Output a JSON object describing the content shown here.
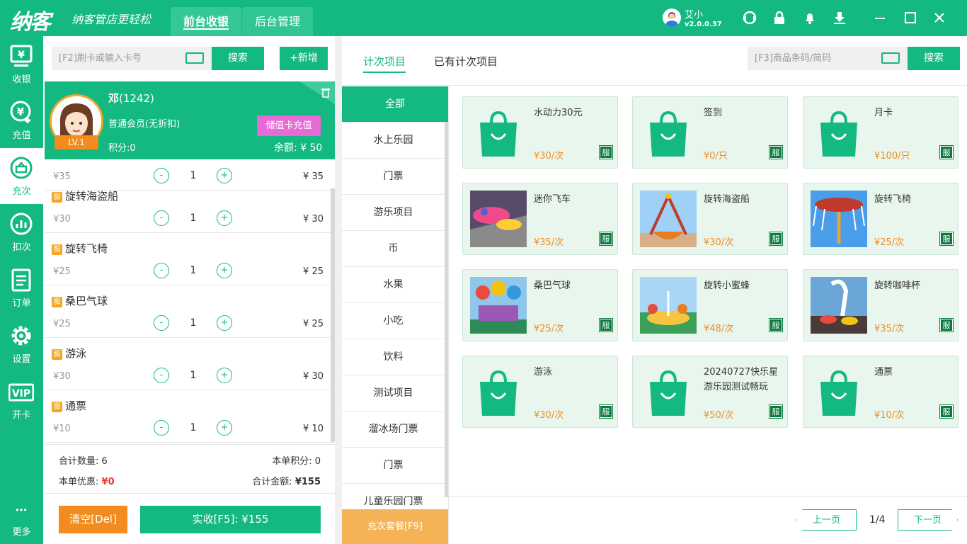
{
  "header": {
    "logo": "纳客",
    "slogan": "纳客管店更轻松",
    "tabs": [
      {
        "label": "前台收银"
      },
      {
        "label": "后台管理"
      }
    ],
    "user": {
      "name": "艾小",
      "version": "v2.0.0.37"
    }
  },
  "nav": [
    {
      "label": "收银",
      "icon": "cashier-icon"
    },
    {
      "label": "充值",
      "icon": "recharge-icon"
    },
    {
      "label": "充次",
      "icon": "recharge-times-icon"
    },
    {
      "label": "扣次",
      "icon": "deduct-times-icon"
    },
    {
      "label": "订单",
      "icon": "order-icon"
    },
    {
      "label": "设置",
      "icon": "settings-icon"
    },
    {
      "label": "开卡",
      "icon": "vip-card-icon"
    },
    {
      "label": "更多",
      "icon": "more-icon"
    }
  ],
  "member_search": {
    "placeholder": "[F2]刷卡或输入卡号",
    "search_label": "搜索",
    "add_label": "+新增"
  },
  "member": {
    "name": "邓",
    "id": "(1242)",
    "type": "普通会员(无折扣)",
    "level": "LV.1",
    "points": "积分:0",
    "balance": "余额: ¥ 50",
    "recharge_label": "储值卡充值"
  },
  "order_items": [
    {
      "name": "",
      "price": "¥35",
      "qty": "1",
      "total": "¥ 35"
    },
    {
      "name": "旋转海盗船",
      "tag": "服",
      "price": "¥30",
      "qty": "1",
      "total": "¥ 30"
    },
    {
      "name": "旋转飞椅",
      "tag": "服",
      "price": "¥25",
      "qty": "1",
      "total": "¥ 25"
    },
    {
      "name": "桑巴气球",
      "tag": "服",
      "price": "¥25",
      "qty": "1",
      "total": "¥ 25"
    },
    {
      "name": "游泳",
      "tag": "服",
      "price": "¥30",
      "qty": "1",
      "total": "¥ 30"
    },
    {
      "name": "通票",
      "tag": "服",
      "price": "¥10",
      "qty": "1",
      "total": "¥ 10"
    }
  ],
  "summary": {
    "count_label": "合计数量:",
    "count": "6",
    "points_label": "本单积分:",
    "points": "0",
    "discount_label": "本单优惠:",
    "discount": "¥0",
    "total_label": "合计金额:",
    "total": "¥155"
  },
  "actions": {
    "clear_label": "清空[Del]",
    "pay_label": "实收[F5]: ¥155"
  },
  "right_tabs": [
    {
      "label": "计次项目"
    },
    {
      "label": "已有计次项目"
    }
  ],
  "sku_search": {
    "placeholder": "[F3]商品条码/简码",
    "search_label": "搜索"
  },
  "categories": [
    "全部",
    "水上乐园",
    "门票",
    "游乐项目",
    "币",
    "水果",
    "小吃",
    "饮料",
    "测试项目",
    "溜冰场门票",
    "门票",
    "儿童乐园门票"
  ],
  "package_label": "充次套餐[F9]",
  "products": [
    {
      "name": "水动力30元",
      "price": "¥30/次",
      "tag": "服",
      "image": "bag-icon"
    },
    {
      "name": "签到",
      "price": "¥0/只",
      "tag": "服",
      "image": "bag-icon"
    },
    {
      "name": "月卡",
      "price": "¥100/只",
      "tag": "服",
      "image": "bag-icon"
    },
    {
      "name": "迷你飞车",
      "price": "¥35/次",
      "tag": "服",
      "image": "photo"
    },
    {
      "name": "旋转海盗船",
      "price": "¥30/次",
      "tag": "服",
      "image": "photo"
    },
    {
      "name": "旋转飞椅",
      "price": "¥25/次",
      "tag": "服",
      "image": "photo"
    },
    {
      "name": "桑巴气球",
      "price": "¥25/次",
      "tag": "服",
      "image": "photo"
    },
    {
      "name": "旋转小蜜蜂",
      "price": "¥48/次",
      "tag": "服",
      "image": "photo"
    },
    {
      "name": "旋转咖啡杯",
      "price": "¥35/次",
      "tag": "服",
      "image": "photo"
    },
    {
      "name": "游泳",
      "price": "¥30/次",
      "tag": "服",
      "image": "bag-icon"
    },
    {
      "name": "20240727快乐星游乐园测试畅玩",
      "price": "¥50/次",
      "tag": "服",
      "image": "bag-icon"
    },
    {
      "name": "通票",
      "price": "¥10/次",
      "tag": "服",
      "image": "bag-icon"
    }
  ],
  "pager": {
    "prev_label": "上一页",
    "next_label": "下一页",
    "page": "1/4"
  },
  "colors": {
    "primary": "#14b881",
    "orange": "#f28c1e",
    "pink": "#e86ad7"
  }
}
